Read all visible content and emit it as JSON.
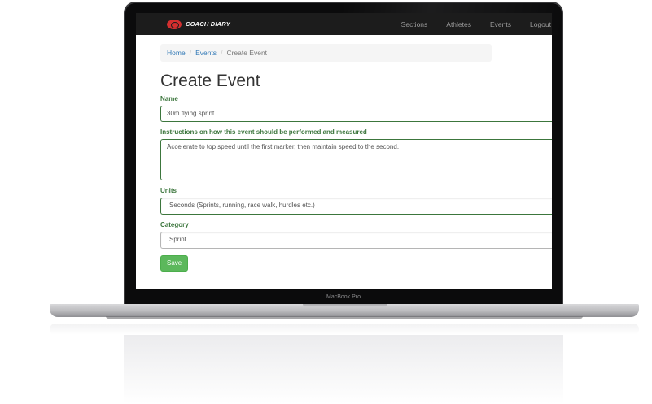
{
  "brand": {
    "name": "COACH DIARY",
    "mark_color": "#d32f2f"
  },
  "nav": {
    "items": [
      "Sections",
      "Athletes",
      "Events",
      "Logout"
    ]
  },
  "breadcrumb": {
    "home": "Home",
    "events": "Events",
    "current": "Create Event",
    "separator": "/"
  },
  "page": {
    "title": "Create Event"
  },
  "form": {
    "name": {
      "label": "Name",
      "value": "30m flying sprint"
    },
    "instructions": {
      "label": "Instructions on how this event should be performed and measured",
      "value": "Accelerate to top speed until the first marker, then maintain speed to the second."
    },
    "units": {
      "label": "Units",
      "value": "Seconds (Sprints, running, race walk, hurdles etc.)"
    },
    "category": {
      "label": "Category",
      "value": "Sprint"
    },
    "save_label": "Save"
  },
  "device": {
    "label": "MacBook Pro"
  },
  "colors": {
    "success": "#3c763d",
    "button": "#5cb85c",
    "link": "#337ab7",
    "navbar": "#1c1c1c"
  }
}
